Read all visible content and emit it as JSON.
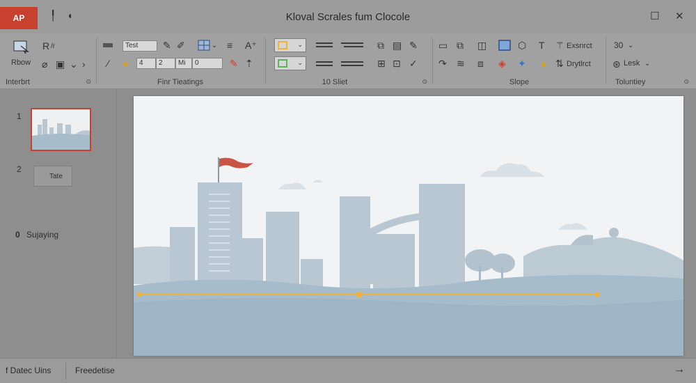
{
  "titlebar": {
    "app_badge": "AP",
    "title": "Kloval Scrales fum Clocole",
    "maximize_glyph": "☐",
    "close_glyph": "✕"
  },
  "ribbon": {
    "groups": {
      "insert": {
        "label": "Interbrt",
        "show_label": "Rbow",
        "r_label": "R",
        "r_sub": "/r"
      },
      "font": {
        "label": "Finr Tieatings",
        "font_name": "Test",
        "size_a": "4",
        "size_b": "2",
        "size_c": "Mi",
        "size_d": "0"
      },
      "slides": {
        "label": "10 Sliet"
      },
      "slope": {
        "label": "Slope",
        "btn_top": "Exsnrct",
        "btn_bottom": "Drytlrct"
      },
      "tools": {
        "label": "Toluntiey",
        "btn_top": "30",
        "btn_bottom": "Lesk"
      }
    },
    "accent_colors": {
      "orange": "#f0b23a",
      "green": "#5bb35b",
      "blue": "#3b73c4",
      "red": "#c8412f"
    }
  },
  "slides_pane": {
    "slides": [
      {
        "number": "1"
      },
      {
        "number": "2",
        "label": "Tate"
      }
    ],
    "section_icon": "0",
    "section_label": "Sujaying"
  },
  "statusbar": {
    "left": "f Datec Uins",
    "mid": "Freedetise",
    "right_icon": "→"
  },
  "slide_art": {
    "flag_color": "#c85545",
    "building_color": "#b8c7d2",
    "water_color": "#a6bccb",
    "line_color": "#f0b23a"
  }
}
